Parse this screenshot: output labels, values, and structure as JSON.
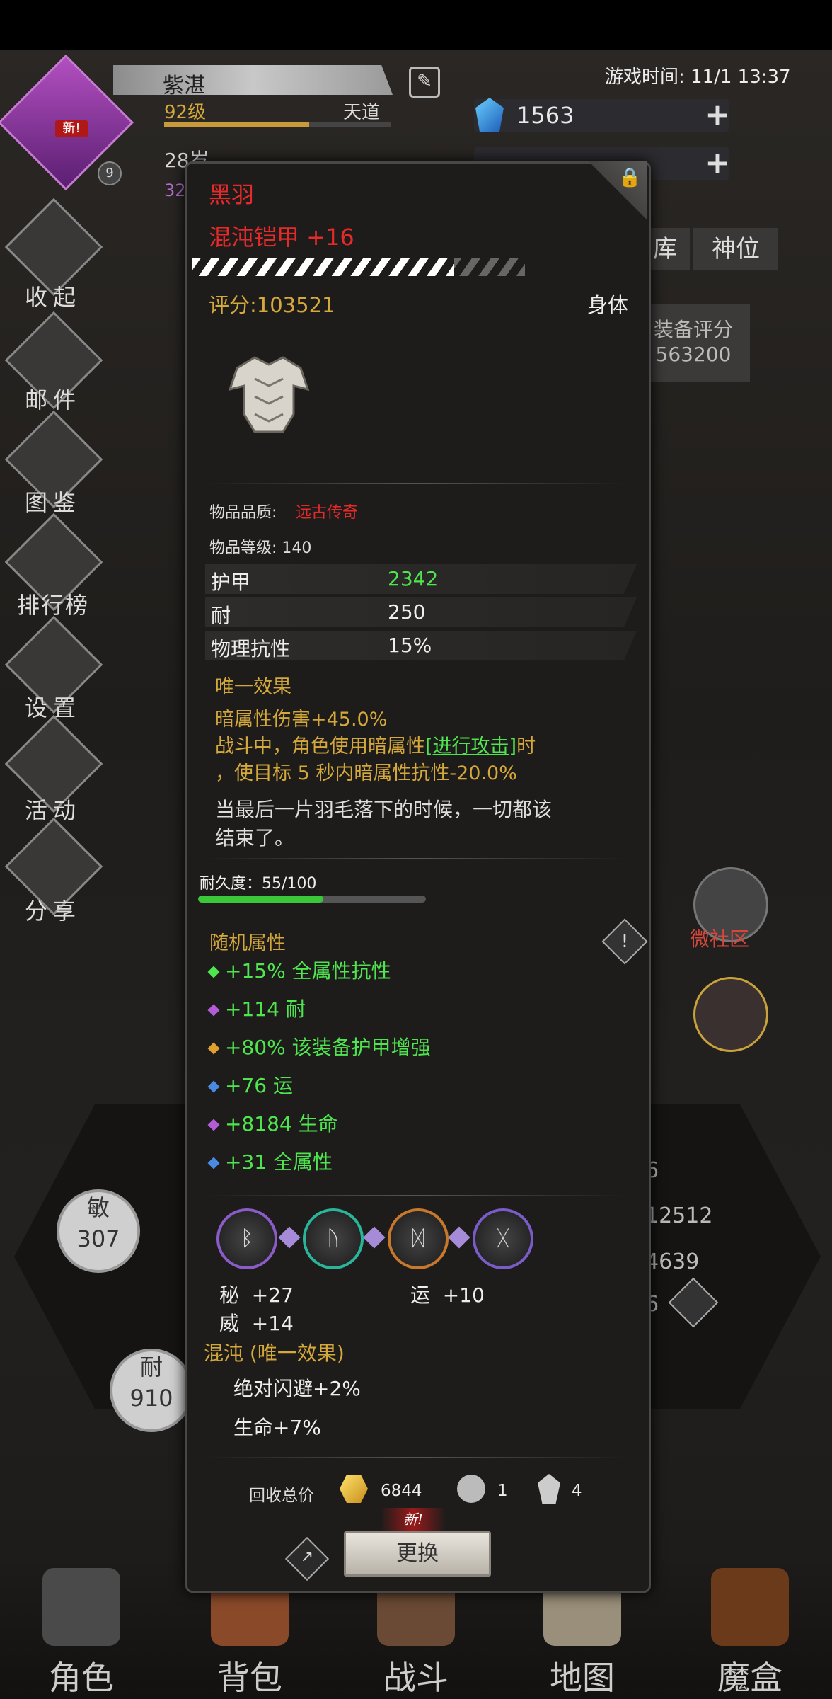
{
  "header": {
    "player_name": "紫湛",
    "level": "92级",
    "realm": "天道",
    "age": "28岁",
    "age_sub": "32",
    "new_badge": "新!",
    "avatar_count": "9",
    "game_time": "游戏时间: 11/1 13:37",
    "gems": "1563"
  },
  "left_menu": [
    {
      "label": "收起",
      "icon": "collapse-icon"
    },
    {
      "label": "邮件",
      "icon": "mail-icon"
    },
    {
      "label": "图鉴",
      "icon": "book-icon"
    },
    {
      "label": "排行榜",
      "icon": "ranking-icon"
    },
    {
      "label": "设置",
      "icon": "gear-icon"
    },
    {
      "label": "活动",
      "icon": "event-icon"
    },
    {
      "label": "分享",
      "icon": "share-icon"
    }
  ],
  "background": {
    "tabs": [
      "库",
      "神位"
    ],
    "score_label": "装备评分",
    "score_value": "563200",
    "community_label": "微社区",
    "stat_min": {
      "label": "敏",
      "value": "307"
    },
    "stat_end": {
      "label": "耐",
      "value": "910"
    },
    "right_values": [
      "6",
      "12512",
      "4639",
      "6"
    ]
  },
  "tooltip": {
    "item_name": "黑羽",
    "item_type": "混沌铠甲 +16",
    "score": "评分:103521",
    "slot": "身体",
    "quality_label": "物品品质:",
    "quality_value": "远古传奇",
    "quality_color": "#e52a2a",
    "level_label": "物品等级: 140",
    "stats": [
      {
        "name": "护甲",
        "value": "2342",
        "color": "#4fe54f"
      },
      {
        "name": "耐",
        "value": "250",
        "color": "#eeeeee"
      },
      {
        "name": "物理抗性",
        "value": "15%",
        "color": "#eeeeee"
      }
    ],
    "unique_title": "唯一效果",
    "unique_lines": [
      "暗属性伤害+45.0%",
      "战斗中，角色使用暗属性",
      "[进行攻击]",
      "时",
      "，使目标 5 秒内暗属性抗性-20.0%"
    ],
    "flavor": [
      "当最后一片羽毛落下的时候，一切都该",
      "结束了。"
    ],
    "durability_label": "耐久度：55/100",
    "durability_fraction": 0.55,
    "random_title": "随机属性",
    "random_attrs": [
      {
        "text": "+15% 全属性抗性",
        "bullet": "#4fe54f"
      },
      {
        "text": "+114 耐",
        "bullet": "#b25cd8"
      },
      {
        "text": "+80% 该装备护甲增强",
        "bullet": "#e0a030"
      },
      {
        "text": "+76 运",
        "bullet": "#4a8ae0"
      },
      {
        "text": "+8184 生命",
        "bullet": "#b25cd8"
      },
      {
        "text": "+31 全属性",
        "bullet": "#4a8ae0"
      }
    ],
    "gems": [
      {
        "glyph": "ᛒ",
        "ring": "#8a5cc8"
      },
      {
        "glyph": "ᚢ",
        "ring": "#2ab59a"
      },
      {
        "glyph": "ᛞ",
        "ring": "#c8782a"
      },
      {
        "glyph": "ᚷ",
        "ring": "#7a5cc8"
      }
    ],
    "gem_bonuses": [
      "秘  +27",
      "运  +10",
      "威  +14"
    ],
    "set_title": "混沌 (唯一效果)",
    "set_bonuses": [
      "绝对闪避+2%",
      "生命+7%"
    ],
    "recycle_label": "回收总价",
    "recycle_gold": "6844",
    "recycle_stone": "1",
    "recycle_shard": "4",
    "new_badge": "新!",
    "replace_button": "更换"
  },
  "bottom_nav": [
    {
      "label": "角色",
      "icon": "helmet-icon",
      "active": true
    },
    {
      "label": "背包",
      "icon": "backpack-icon"
    },
    {
      "label": "战斗",
      "icon": "sword-shield-icon"
    },
    {
      "label": "地图",
      "icon": "map-scroll-icon"
    },
    {
      "label": "魔盒",
      "icon": "magic-box-icon"
    }
  ]
}
